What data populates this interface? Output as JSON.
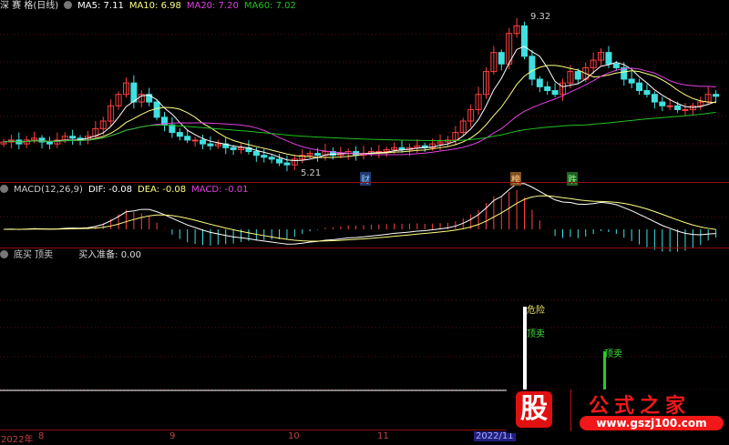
{
  "header": {
    "title": "深 赛 格(日线)",
    "ma5": "MA5: 7.11",
    "ma10": "MA10: 6.98",
    "ma20": "MA20: 7.20",
    "ma60": "MA60: 7.02"
  },
  "price_labels": {
    "high": "9.32",
    "low": "5.21"
  },
  "event_tags": {
    "cai": "财",
    "bang": "榜",
    "die": "跌"
  },
  "macd": {
    "title": "MACD(12,26,9)",
    "dif": "DIF: -0.08",
    "dea": "DEA: -0.08",
    "macd": "MACD: -0.01"
  },
  "signal": {
    "title": "底买 顶卖",
    "buy_ready": "买入准备: 0.00",
    "danger": "危险",
    "top_sell_1": "顶卖",
    "top_sell_2": "顶卖"
  },
  "axis": {
    "year": "2022年",
    "m8": "8",
    "m9": "9",
    "m10": "10",
    "m11": "11",
    "cursor": "2022/11"
  },
  "watermark": {
    "logo": "股",
    "name": "公式之家",
    "url": "www.gszj100.com"
  },
  "colors": {
    "up": "#ff4040",
    "down": "#40e0e0",
    "ma5": "#ffffff",
    "ma10": "#ffff80",
    "ma20": "#e040e0",
    "ma60": "#20c020"
  },
  "closes": [
    5.95,
    6.0,
    5.9,
    6.0,
    6.05,
    5.95,
    5.9,
    6.0,
    6.1,
    6.05,
    6.0,
    6.1,
    6.3,
    6.5,
    6.9,
    7.2,
    7.5,
    7.0,
    7.2,
    7.0,
    6.6,
    6.4,
    6.2,
    6.1,
    6.0,
    6.0,
    5.9,
    5.85,
    5.9,
    5.8,
    5.75,
    5.8,
    5.7,
    5.6,
    5.55,
    5.5,
    5.4,
    5.35,
    5.5,
    5.6,
    5.65,
    5.6,
    5.7,
    5.6,
    5.65,
    5.7,
    5.6,
    5.65,
    5.7,
    5.7,
    5.75,
    5.8,
    5.75,
    5.8,
    5.85,
    5.8,
    5.9,
    5.95,
    6.0,
    6.2,
    6.5,
    6.8,
    7.2,
    7.8,
    8.3,
    8.0,
    8.8,
    9.0,
    8.2,
    7.6,
    7.4,
    7.3,
    7.2,
    7.5,
    7.8,
    7.6,
    7.9,
    8.1,
    8.3,
    8.0,
    7.9,
    7.6,
    7.5,
    7.3,
    7.2,
    7.0,
    6.9,
    6.9,
    6.8,
    6.8,
    6.9,
    7.0,
    7.2,
    7.15
  ]
}
